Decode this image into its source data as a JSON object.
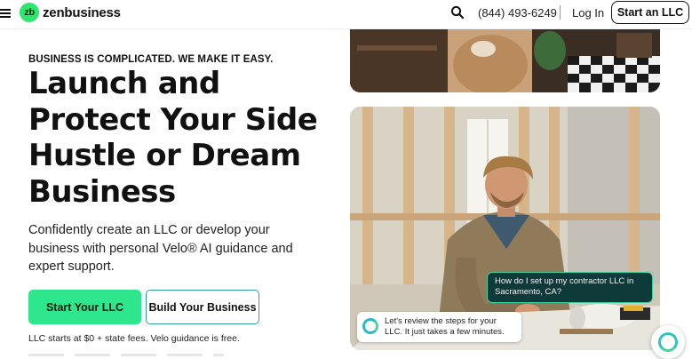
{
  "header": {
    "logo_mark": "zb",
    "logo_text": "zenbusiness",
    "phone": "(844) 493-6249",
    "login_label": "Log In",
    "start_llc_label": "Start an LLC"
  },
  "hero": {
    "eyebrow": "BUSINESS IS COMPLICATED. WE MAKE IT EASY.",
    "headline": "Launch and Protect Your Side Hustle or Dream Business",
    "subtext": "Confidently create an LLC or develop your business with personal Velo® AI guidance and expert support.",
    "primary_cta": "Start Your LLC",
    "secondary_cta": "Build Your Business",
    "fine_print": "LLC starts at $0 + state fees. Velo guidance is free."
  },
  "chat": {
    "user_message": "How do I set up my contractor LLC in Sacramento, CA?",
    "ai_message": "Let's review the steps for your LLC. It just takes a few minutes."
  },
  "colors": {
    "brand_green": "#2ee68b",
    "accent_teal": "#2d9fa0",
    "chat_dark": "#0f3a3a"
  },
  "icons": {
    "menu": "hamburger-icon",
    "search": "search-icon",
    "assistant": "velo-ring-icon"
  }
}
